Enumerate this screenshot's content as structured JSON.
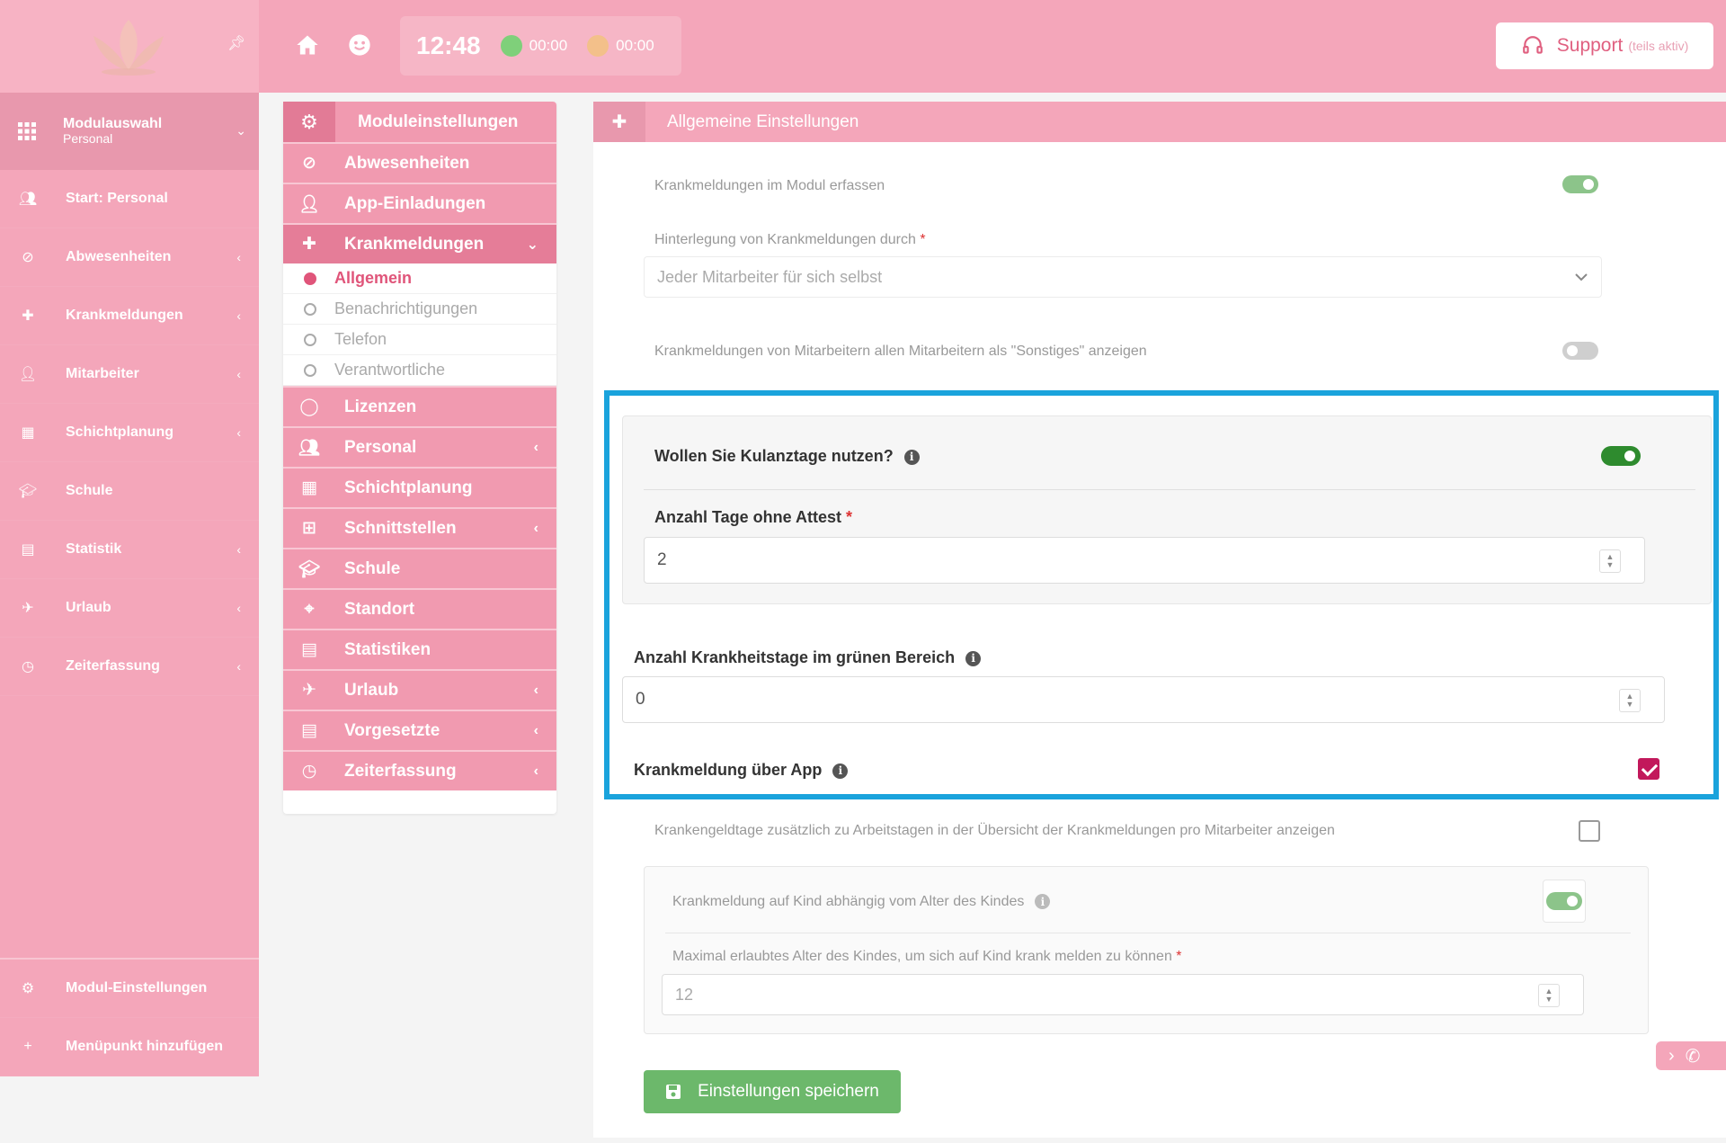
{
  "colors": {
    "accent": "#f4a6ba",
    "highlight": "#1aa3dc",
    "toggle_on": "#8cc48a",
    "toggle_strong": "#2e8b2e",
    "save_green": "#6cb86b",
    "checkbox_checked": "#c2185b"
  },
  "sidebar": {
    "module": {
      "title": "Modulauswahl",
      "subtitle": "Personal",
      "icon": "grid-icon"
    },
    "items": [
      {
        "label": "Start: Personal",
        "icon": "users-icon",
        "has_arrow": false
      },
      {
        "label": "Abwesenheiten",
        "icon": "ban-icon",
        "has_arrow": true
      },
      {
        "label": "Krankmeldungen",
        "icon": "medical-icon",
        "has_arrow": true
      },
      {
        "label": "Mitarbeiter",
        "icon": "user-icon",
        "has_arrow": true
      },
      {
        "label": "Schichtplanung",
        "icon": "calendar-icon",
        "has_arrow": true
      },
      {
        "label": "Schule",
        "icon": "graduation-icon",
        "has_arrow": false
      },
      {
        "label": "Statistik",
        "icon": "chart-icon",
        "has_arrow": true
      },
      {
        "label": "Urlaub",
        "icon": "plane-icon",
        "has_arrow": true
      },
      {
        "label": "Zeiterfassung",
        "icon": "clock-icon",
        "has_arrow": true
      }
    ],
    "bottom": [
      {
        "label": "Modul-Einstellungen",
        "icon": "gear-icon"
      },
      {
        "label": "Menüpunkt hinzufügen",
        "icon": "plus-icon"
      }
    ]
  },
  "topbar": {
    "time": "12:48",
    "timer_green": "00:00",
    "timer_orange": "00:00",
    "support_label": "Support",
    "support_note": "(teils aktiv)"
  },
  "modules_panel": {
    "title": "Moduleinstellungen",
    "items_before": [
      {
        "label": "Abwesenheiten",
        "icon": "ban-icon"
      },
      {
        "label": "App-Einladungen",
        "icon": "user-icon"
      }
    ],
    "active_item": {
      "label": "Krankmeldungen",
      "icon": "medical-icon"
    },
    "subitems": [
      {
        "label": "Allgemein",
        "active": true
      },
      {
        "label": "Benachrichtigungen",
        "active": false
      },
      {
        "label": "Telefon",
        "active": false
      },
      {
        "label": "Verantwortliche",
        "active": false
      }
    ],
    "items_after": [
      {
        "label": "Lizenzen",
        "icon": "circle-icon",
        "has_arrow": false
      },
      {
        "label": "Personal",
        "icon": "users-icon",
        "has_arrow": true
      },
      {
        "label": "Schichtplanung",
        "icon": "calendar-icon",
        "has_arrow": false
      },
      {
        "label": "Schnittstellen",
        "icon": "sitemap-icon",
        "has_arrow": true
      },
      {
        "label": "Schule",
        "icon": "graduation-icon",
        "has_arrow": false
      },
      {
        "label": "Standort",
        "icon": "map-pin-icon",
        "has_arrow": false
      },
      {
        "label": "Statistiken",
        "icon": "chart-icon",
        "has_arrow": false
      },
      {
        "label": "Urlaub",
        "icon": "plane-icon",
        "has_arrow": true
      },
      {
        "label": "Vorgesetzte",
        "icon": "chart-icon",
        "has_arrow": true
      },
      {
        "label": "Zeiterfassung",
        "icon": "clock-icon",
        "has_arrow": true
      }
    ]
  },
  "settings": {
    "title": "Allgemeine Einstellungen",
    "capture_label": "Krankmeldungen im Modul erfassen",
    "capture_on": true,
    "deposit_label": "Hinterlegung von Krankmeldungen durch",
    "deposit_value": "Jeder Mitarbeiter für sich selbst",
    "other_label": "Krankmeldungen von Mitarbeitern allen Mitarbeitern als \"Sonstiges\" anzeigen",
    "other_on": false,
    "kulanz_label": "Wollen Sie Kulanztage nutzen?",
    "kulanz_on": true,
    "days_no_cert_label": "Anzahl Tage ohne Attest",
    "days_no_cert_value": "2",
    "green_days_label": "Anzahl Krankheitstage im grünen Bereich",
    "green_days_value": "0",
    "app_label": "Krankmeldung über App",
    "app_checked": true,
    "sickpay_label": "Krankengeldtage zusätzlich zu Arbeitstagen in der Übersicht der Krankmeldungen pro Mitarbeiter anzeigen",
    "sickpay_checked": false,
    "child_label": "Krankmeldung auf Kind abhängig vom Alter des Kindes",
    "child_on": true,
    "child_age_label": "Maximal erlaubtes Alter des Kindes, um sich auf Kind krank melden zu können",
    "child_age_value": "12",
    "save_label": "Einstellungen speichern"
  }
}
